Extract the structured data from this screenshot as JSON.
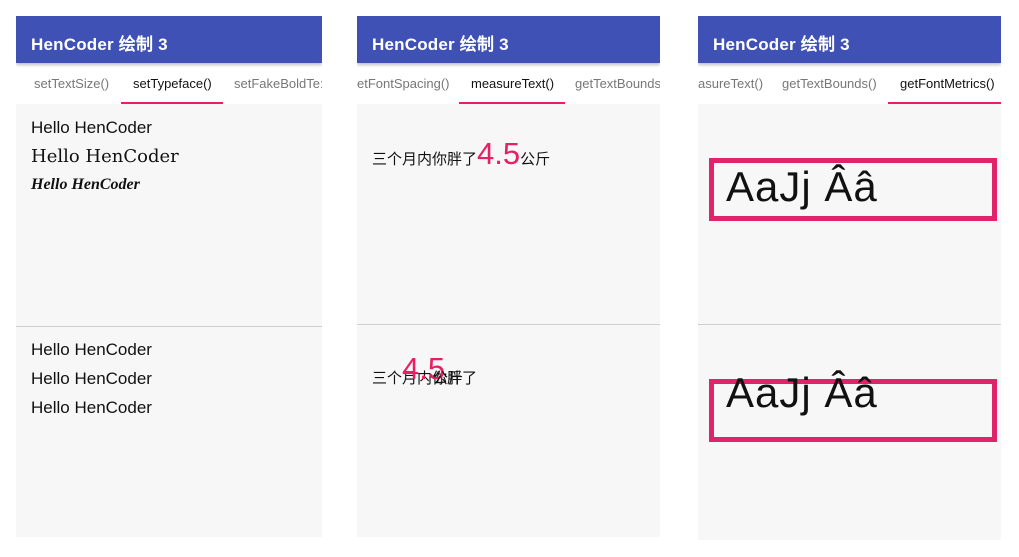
{
  "app_title": "HenCoder 绘制 3",
  "phones": [
    {
      "tabs": [
        "setTextSize()",
        "setTypeface()",
        "setFakeBoldTe:"
      ],
      "active_tab": "setTypeface()",
      "top_lines": [
        "Hello HenCoder",
        "Hello HenCoder",
        "Hello HenCoder"
      ],
      "bottom_lines": [
        "Hello HenCoder",
        "Hello HenCoder",
        "Hello HenCoder"
      ]
    },
    {
      "tabs": [
        "etFontSpacing()",
        "measureText()",
        "getTextBounds"
      ],
      "active_tab": "measureText()",
      "top": {
        "prefix": "三个月内你胖了",
        "number": "4.5",
        "suffix": "公斤"
      },
      "bottom": {
        "prefix": "三个月内你胖了",
        "number": "4.5",
        "suffix": "公斤"
      }
    },
    {
      "tabs": [
        "asureText()",
        "getTextBounds()",
        "getFontMetrics()"
      ],
      "active_tab": "getFontMetrics()",
      "top_text": "AaJj Ââ",
      "bottom_text": "AaJj Ââ"
    }
  ],
  "colors": {
    "app_bar": "#3f51b5",
    "accent": "#e91e63",
    "panel_bg": "#f7f7f7"
  }
}
